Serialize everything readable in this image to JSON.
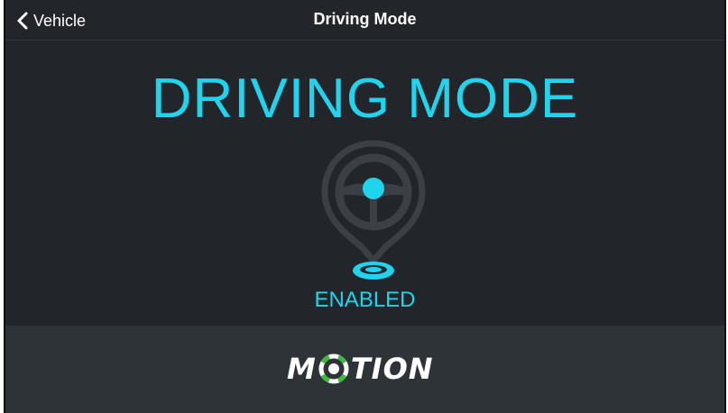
{
  "nav": {
    "back_label": "Vehicle",
    "title": "Driving Mode"
  },
  "main": {
    "heading": "DRIVING MODE",
    "icon": "steering-wheel-location-pin-icon",
    "status": "ENABLED"
  },
  "footer": {
    "logo_text_left": "M",
    "logo_text_right": "TION",
    "logo_icon": "target-o-icon"
  },
  "colors": {
    "background": "#22262b",
    "footer_background": "#2e3338",
    "accent": "#21d4ee",
    "logo_green": "#3dbb3d",
    "icon_gray": "#3b4046"
  }
}
